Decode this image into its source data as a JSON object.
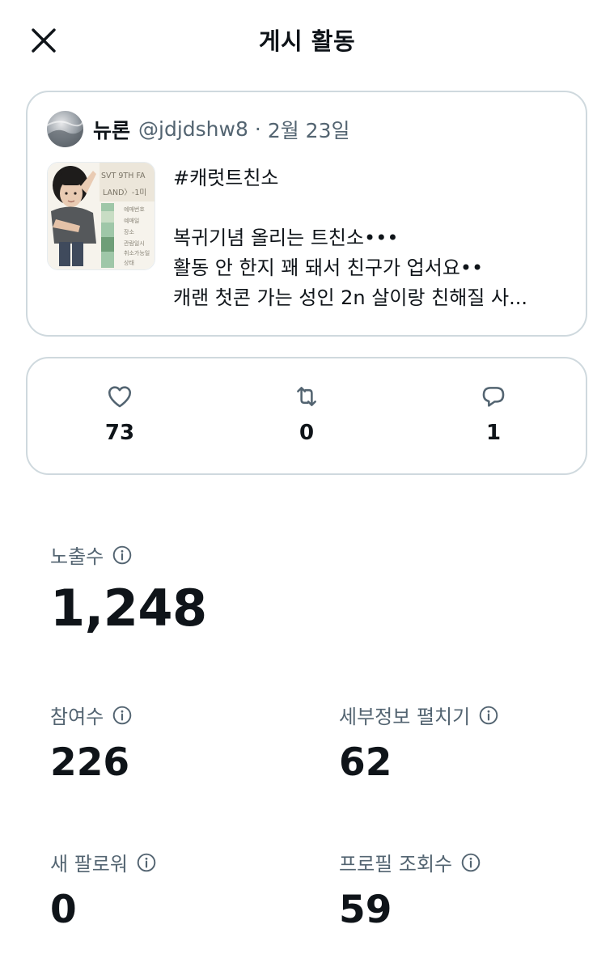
{
  "header": {
    "title": "게시 활동",
    "close_icon": "close-icon"
  },
  "post": {
    "author_name": "뉴론",
    "author_handle": "@jdjdshw8",
    "separator": "·",
    "date": "2월 23일",
    "thumbnail_text": {
      "top_line_1": "SVT 9TH FA",
      "top_line_2": "LAND〉-1미",
      "fields": [
        "예매번호",
        "예매일",
        "장소",
        "관람일시",
        "취소가능일",
        "상태"
      ]
    },
    "lines": [
      "#캐럿트친소",
      "",
      "복귀기념 올리는 트친소•••",
      "활동 안 한지 꽤 돼서 친구가 업서요••",
      "캐랜 첫콘 가는 성인 2n 살이랑 친해질 사..."
    ]
  },
  "engagement": {
    "likes": {
      "icon": "heart-icon",
      "value": "73"
    },
    "retweets": {
      "icon": "retweet-icon",
      "value": "0"
    },
    "replies": {
      "icon": "reply-icon",
      "value": "1"
    }
  },
  "metrics": {
    "impressions": {
      "label": "노출수",
      "value": "1,248"
    },
    "engagements": {
      "label": "참여수",
      "value": "226"
    },
    "detail_expands": {
      "label": "세부정보 펼치기",
      "value": "62"
    },
    "new_followers": {
      "label": "새 팔로워",
      "value": "0"
    },
    "profile_visits": {
      "label": "프로필 조회수",
      "value": "59"
    }
  },
  "colors": {
    "text_primary": "#0f1419",
    "text_secondary": "#536471",
    "border": "#cfd9de",
    "background": "#ffffff"
  }
}
